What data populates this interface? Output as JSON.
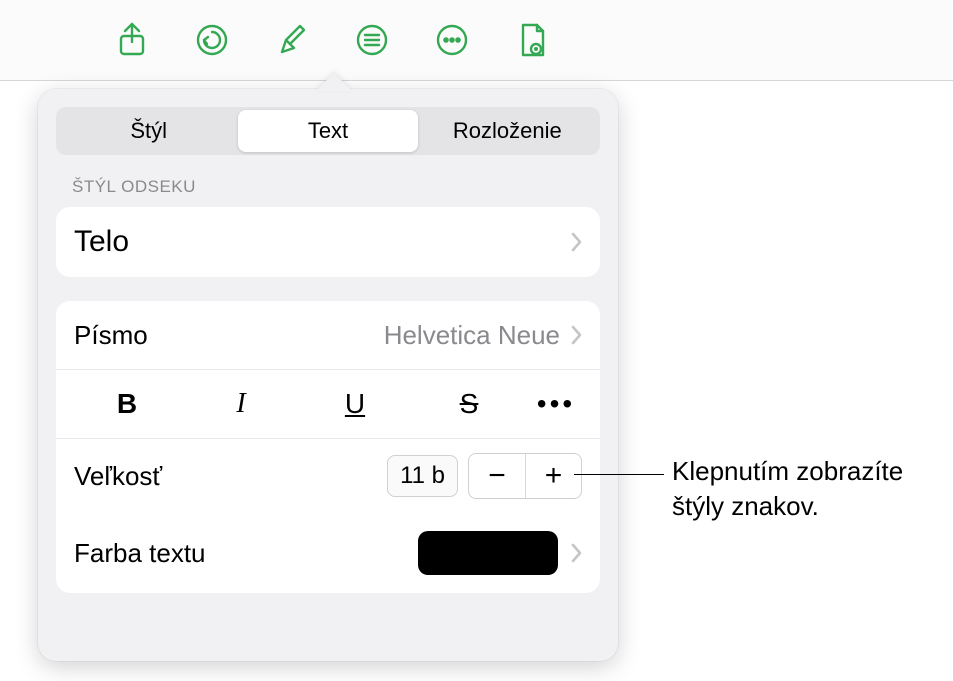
{
  "toolbar": {
    "icons": [
      "share",
      "undo",
      "format",
      "insert",
      "more",
      "document"
    ]
  },
  "tabs": {
    "items": [
      {
        "label": "Štýl"
      },
      {
        "label": "Text"
      },
      {
        "label": "Rozloženie"
      }
    ]
  },
  "section_paragraph_style": "ŠTÝL ODSEKU",
  "paragraph_style": {
    "value": "Telo"
  },
  "font": {
    "label": "Písmo",
    "value": "Helvetica Neue"
  },
  "styles": {
    "bold": "B",
    "italic": "I",
    "underline": "U",
    "strike": "S",
    "more": "•••"
  },
  "size": {
    "label": "Veľkosť",
    "value": "11 b"
  },
  "text_color": {
    "label": "Farba textu",
    "value": "#000000"
  },
  "callout": {
    "line1": "Klepnutím zobrazíte",
    "line2": "štýly znakov."
  }
}
